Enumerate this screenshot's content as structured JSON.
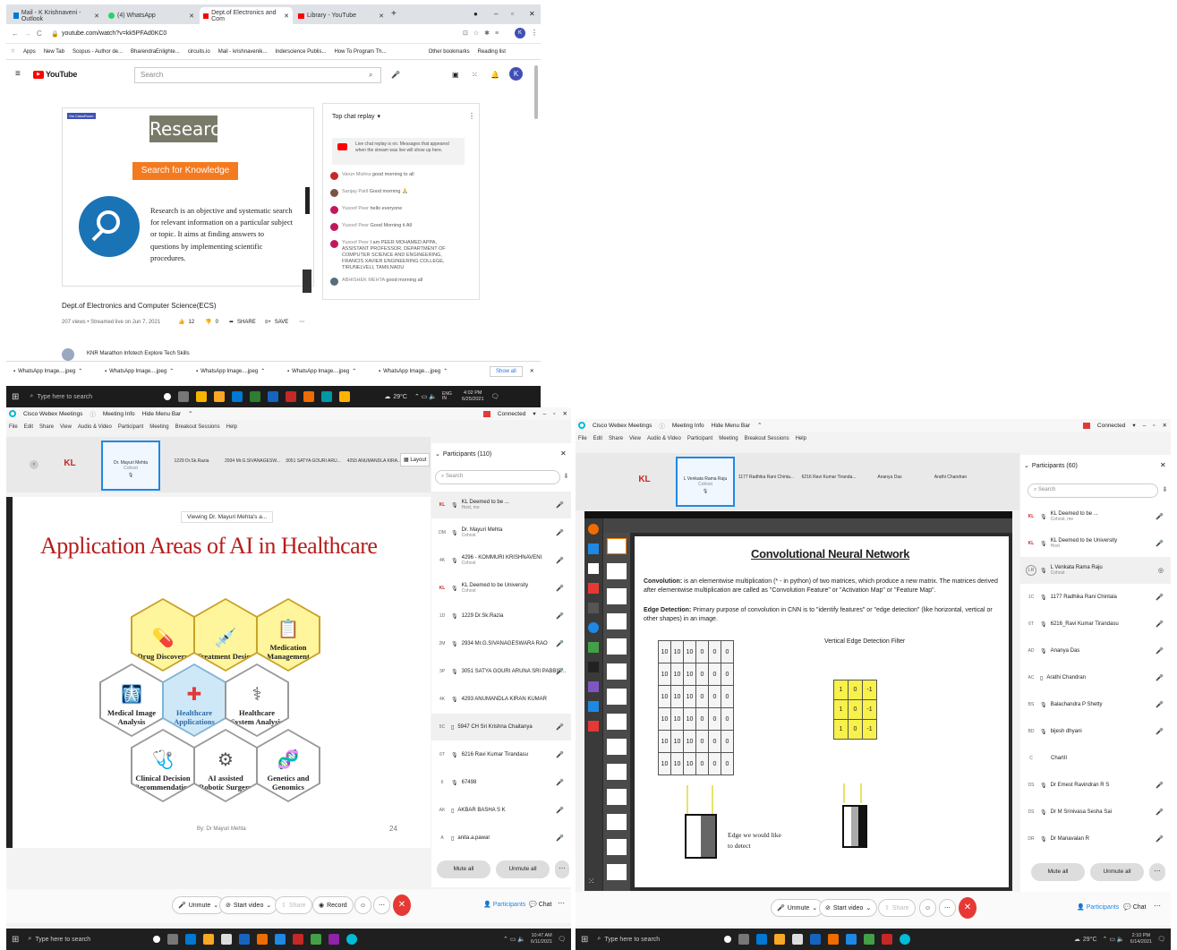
{
  "browser": {
    "tabs": [
      {
        "label": "Mail - K Krishnaveni - Outlook",
        "color": "#0078d4"
      },
      {
        "label": "(4) WhatsApp",
        "color": "#25d366"
      },
      {
        "label": "Dept.of Electronics and Com",
        "color": "#ff0000"
      },
      {
        "label": "Library - YouTube",
        "color": "#ff0000"
      }
    ],
    "url": "youtube.com/watch?v=kk5PFAd0KC0",
    "bookmarks": [
      "Apps",
      "New Tab",
      "Scopus - Author de...",
      "BharendraEnlighte...",
      "circuits.io",
      "Mail - krishnavenik...",
      "Inderscience Publis...",
      "How To Program Th..."
    ],
    "other_bookmarks": "Other bookmarks",
    "reading_list": "Reading list",
    "yt_logo": "YouTube",
    "search_placeholder": "Search",
    "avatar": "K",
    "slide_badge": "Via ClassRoom",
    "slide_title": "Research",
    "slide_subtitle": "Search for Knowledge",
    "slide_body": "Research is an objective and systematic search for relevant information on a particular subject or topic. It aims at finding answers to questions by implementing scientific procedures.",
    "video_title": "Dept.of Electronics and Computer Science(ECS)",
    "video_meta": "207 views • Streamed live on Jun 7, 2021",
    "likes": "12",
    "dislikes": "0",
    "share": "SHARE",
    "save": "SAVE",
    "next_video": "KNR Marathon Infotech Explore Tech Skills",
    "chat_header": "Top chat replay",
    "chat_notice": "Live chat replay is on. Messages that appeared when the stream was live will show up here.",
    "chat": [
      {
        "name": "Varun Mishra",
        "text": "good morning to all",
        "color": "#c62828"
      },
      {
        "name": "Sanjay Patil",
        "text": "Good morning 🙏",
        "color": "#795548"
      },
      {
        "name": "Yusoof Peer",
        "text": "hello everyone",
        "color": "#c2185b"
      },
      {
        "name": "Yusoof Peer",
        "text": "Good Morning ti All",
        "color": "#c2185b"
      },
      {
        "name": "Yusoof Peer",
        "text": "I am PEER MOHAMED APPA, ASSISTANT PROFESSOR, DEPARTMENT OF COMPUTER SCIENCE AND ENGINEERING, FRANCIS XAVIER ENGINEERING COLLEGE, TIRUNELVELI, TAMILNADU",
        "color": "#c2185b"
      },
      {
        "name": "ABHISHEK MEHTA",
        "text": "good morning all",
        "color": "#546e7a"
      }
    ],
    "downloads": [
      "WhatsApp Image....jpeg",
      "WhatsApp Image....jpeg",
      "WhatsApp Image....jpeg",
      "WhatsApp Image....jpeg",
      "WhatsApp Image....jpeg"
    ],
    "show_all": "Show all",
    "taskbar_search": "Type here to search",
    "weather": "29°C",
    "lang": "ENG IN",
    "time": "4:02 PM",
    "date": "6/25/2021"
  },
  "webex_left": {
    "app": "Cisco Webex Meetings",
    "meeting_info": "Meeting Info",
    "hide_menu": "Hide Menu Bar",
    "connected": "Connected",
    "menus": [
      "File",
      "Edit",
      "Share",
      "View",
      "Audio & Video",
      "Participant",
      "Meeting",
      "Breakout Sessions",
      "Help"
    ],
    "thumbs": [
      {
        "label": "",
        "sub": "",
        "logo": "KL"
      },
      {
        "label": "Dr. Mayuri Mehta",
        "sub": "Cohost",
        "logo": ""
      },
      {
        "label": "1229 Dr.Sk.Razia",
        "sub": "",
        "logo": ""
      },
      {
        "label": "2934 Mr.G.SIVANAGESW...",
        "sub": "",
        "logo": ""
      },
      {
        "label": "3051 SATYA GOURI ARU...",
        "sub": "",
        "logo": ""
      },
      {
        "label": "4293 ANUMANDLA KIRA...",
        "sub": "",
        "logo": ""
      }
    ],
    "layout": "Layout",
    "viewing": "Viewing Dr. Mayuri Mehta's a...",
    "slide_title": "Application Areas of AI in Healthcare",
    "hexes": [
      "Drug Discovery",
      "Treatment Design",
      "Medication Management",
      "Medical Image Analysis",
      "Healthcare Applications",
      "Healthcare System Analysis",
      "Clinical Decision Recommendation",
      "AI assisted Robotic Surgery",
      "Genetics and Genomics"
    ],
    "slide_footer": "By: Dr Mayuri Mehta",
    "slide_number": "24",
    "participants_header": "Participants (110)",
    "search": "Search",
    "participants": [
      {
        "ini": "KL",
        "name": "KL Deemed to be ...",
        "sub": "Host, me"
      },
      {
        "ini": "DM",
        "name": "Dr. Mayuri Mehta",
        "sub": "Cohost"
      },
      {
        "ini": "4K",
        "name": "4296 - KOMMURI KRISHNAVENI",
        "sub": "Cohost"
      },
      {
        "ini": "KL",
        "name": "KL Deemed to be University",
        "sub": "Cohost"
      },
      {
        "ini": "1D",
        "name": "1229 Dr.Sk.Razia",
        "sub": ""
      },
      {
        "ini": "2M",
        "name": "2934 Mr.G.SIVANAGESWARA RAO",
        "sub": ""
      },
      {
        "ini": "3P",
        "name": "3051 SATYA GOURI ARUNA SRI PABBIS...",
        "sub": ""
      },
      {
        "ini": "4K",
        "name": "4293 ANUMANDLA KIRAN KUMAR",
        "sub": ""
      },
      {
        "ini": "5C",
        "name": "5947 CH Sri Krishna Chaitanya",
        "sub": ""
      },
      {
        "ini": "6T",
        "name": "6216 Ravi Kumar Tirandasu",
        "sub": ""
      },
      {
        "ini": "6",
        "name": "67498",
        "sub": ""
      },
      {
        "ini": "AK",
        "name": "AKBAR BASHA S K",
        "sub": ""
      },
      {
        "ini": "A",
        "name": "anita.a.pawar",
        "sub": ""
      }
    ],
    "mute_all": "Mute all",
    "unmute_all": "Unmute all",
    "controls": [
      "Unmute",
      "Start video",
      "Share",
      "Record"
    ],
    "participants_btn": "Participants",
    "chat_btn": "Chat",
    "taskbar_search": "Type here to search",
    "time": "10:47 AM",
    "date": "6/11/2021"
  },
  "webex_right": {
    "app": "Cisco Webex Meetings",
    "meeting_info": "Meeting Info",
    "hide_menu": "Hide Menu Bar",
    "connected": "Connected",
    "menus": [
      "File",
      "Edit",
      "Share",
      "View",
      "Audio & Video",
      "Participant",
      "Meeting",
      "Breakout Sessions",
      "Help"
    ],
    "thumbs": [
      {
        "label": "",
        "sub": "",
        "logo": "KL"
      },
      {
        "label": "L Venkata Rama Raju",
        "sub": "Cohost",
        "logo": ""
      },
      {
        "label": "1177 Radhika Rani Chinta...",
        "sub": "",
        "logo": ""
      },
      {
        "label": "6216 Ravi Kumar Tiranda...",
        "sub": "",
        "logo": ""
      },
      {
        "label": "Ananya Das",
        "sub": "",
        "logo": ""
      },
      {
        "label": "Arathi Chandran",
        "sub": "",
        "logo": ""
      }
    ],
    "slide_title": "Convolutional Neural Network",
    "convolution_label": "Convolution:",
    "convolution_text": "is an elementwise multiplication (* - in python) of two matrices, which produce a new matrix. The matrices derived after elementwise multiplication are called as \"Convolution Feature\" or \"Activation Map\" or \"Feature Map\".",
    "edge_label": "Edge Detection:",
    "edge_text": "Primary purpose of convolution in CNN is to \"identify features\" or \"edge detection\" (like horizontal, vertical or other shapes) in an image.",
    "filter_label": "Vertical Edge Detection Filter",
    "matrix": [
      [
        "10",
        "10",
        "10",
        "0",
        "0",
        "0"
      ],
      [
        "10",
        "10",
        "10",
        "0",
        "0",
        "0"
      ],
      [
        "10",
        "10",
        "10",
        "0",
        "0",
        "0"
      ],
      [
        "10",
        "10",
        "10",
        "0",
        "0",
        "0"
      ],
      [
        "10",
        "10",
        "10",
        "0",
        "0",
        "0"
      ],
      [
        "10",
        "10",
        "10",
        "0",
        "0",
        "0"
      ]
    ],
    "filter": [
      [
        "1",
        "0",
        "-1"
      ],
      [
        "1",
        "0",
        "-1"
      ],
      [
        "1",
        "0",
        "-1"
      ]
    ],
    "edge_note": "Edge we would like to detect",
    "participants_header": "Participants (60)",
    "search": "Search",
    "participants": [
      {
        "ini": "KL",
        "name": "KL Deemed to be ...",
        "sub": "Cohost, me"
      },
      {
        "ini": "KL",
        "name": "KL Deemed to be University",
        "sub": "Host"
      },
      {
        "ini": "LR",
        "name": "L Venkata Rama Raju",
        "sub": "Cohost"
      },
      {
        "ini": "1C",
        "name": "1177 Radhika Rani Chintala",
        "sub": ""
      },
      {
        "ini": "6T",
        "name": "6216_Ravi Kumar Tirandasu",
        "sub": ""
      },
      {
        "ini": "AD",
        "name": "Ananya Das",
        "sub": ""
      },
      {
        "ini": "AC",
        "name": "Arathi Chandran",
        "sub": ""
      },
      {
        "ini": "BS",
        "name": "Balachandra P Shetty",
        "sub": ""
      },
      {
        "ini": "BD",
        "name": "bijesh dhyani",
        "sub": ""
      },
      {
        "ini": "C",
        "name": "ChartII",
        "sub": ""
      },
      {
        "ini": "DS",
        "name": "Dr Emest Ravindran R S",
        "sub": ""
      },
      {
        "ini": "DS",
        "name": "Dr M Srinivasa Sesha Sai",
        "sub": ""
      },
      {
        "ini": "DR",
        "name": "Dr Manavalan R",
        "sub": ""
      }
    ],
    "mute_all": "Mute all",
    "unmute_all": "Unmute all",
    "controls": [
      "Unmute",
      "Start video",
      "Share"
    ],
    "participants_btn": "Participants",
    "chat_btn": "Chat",
    "taskbar_search": "Type here to search",
    "weather": "29°C",
    "time": "2:10 PM",
    "date": "6/14/2021"
  }
}
